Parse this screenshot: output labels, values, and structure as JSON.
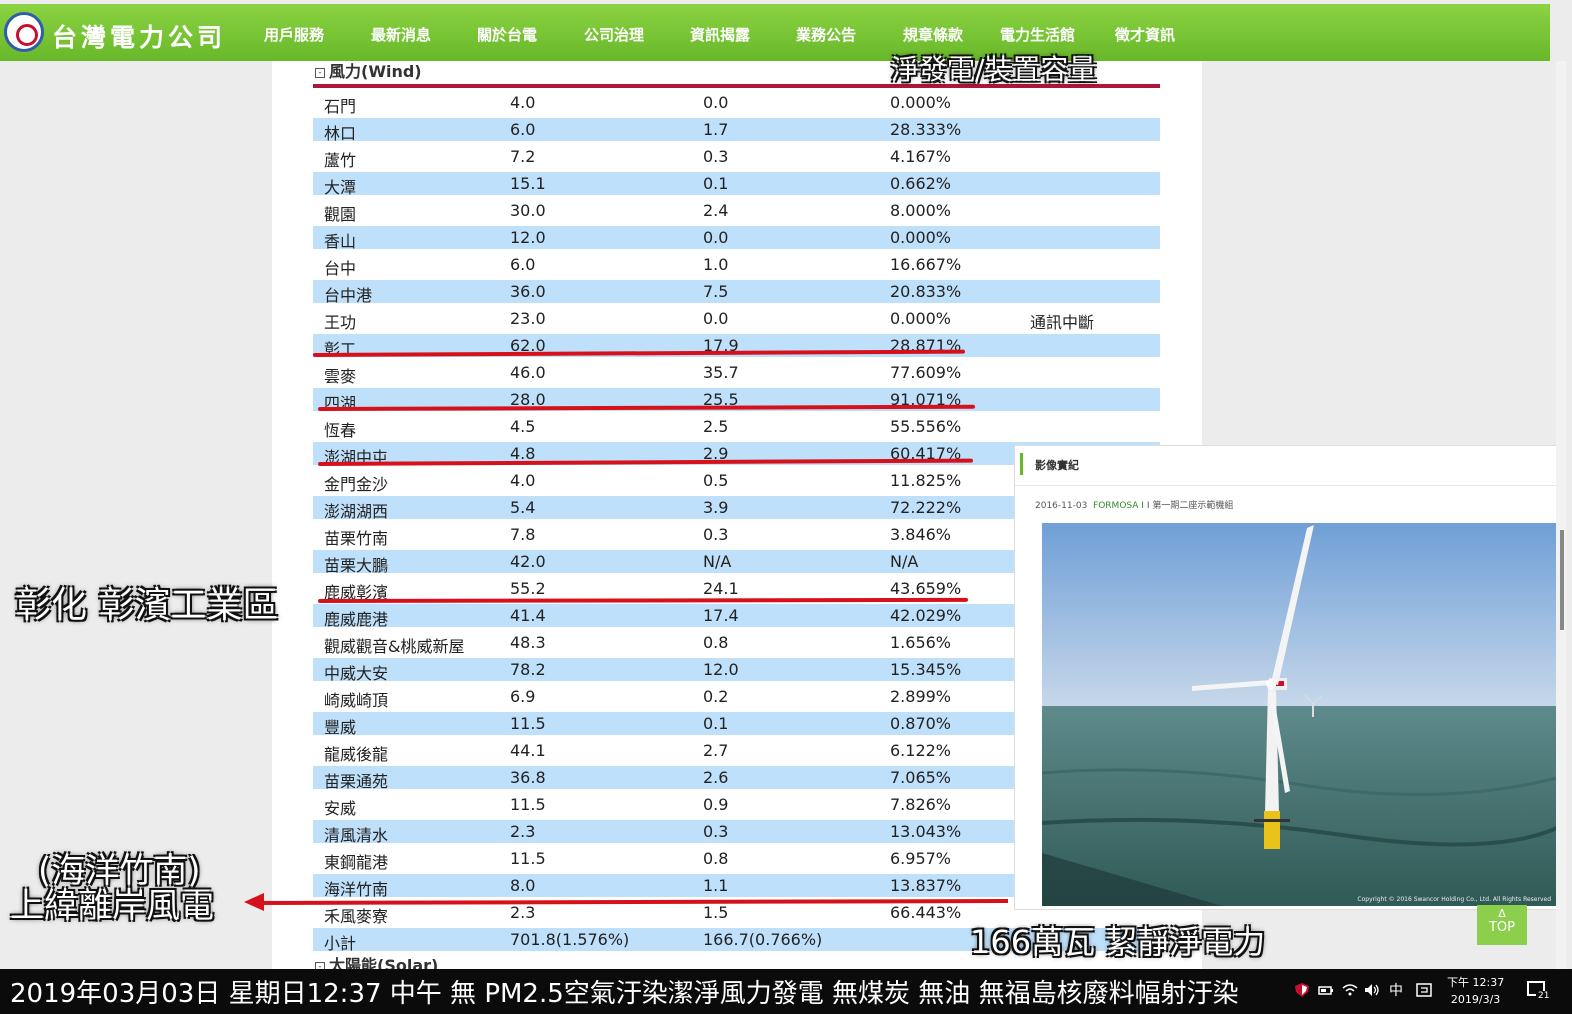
{
  "site": {
    "brand": "台灣電力公司",
    "nav": [
      "用戶服務",
      "最新消息",
      "關於台電",
      "公司治理",
      "資訊揭露",
      "業務公告",
      "規章條款",
      "電力生活館",
      "徵才資訊"
    ]
  },
  "section": {
    "toggle": "⊟",
    "title": "風力(Wind)"
  },
  "table": {
    "rows": [
      {
        "name": "石門",
        "capacity": "4.0",
        "net": "0.0",
        "ratio": "0.000%",
        "note": ""
      },
      {
        "name": "林口",
        "capacity": "6.0",
        "net": "1.7",
        "ratio": "28.333%",
        "note": ""
      },
      {
        "name": "蘆竹",
        "capacity": "7.2",
        "net": "0.3",
        "ratio": "4.167%",
        "note": ""
      },
      {
        "name": "大潭",
        "capacity": "15.1",
        "net": "0.1",
        "ratio": "0.662%",
        "note": ""
      },
      {
        "name": "觀園",
        "capacity": "30.0",
        "net": "2.4",
        "ratio": "8.000%",
        "note": ""
      },
      {
        "name": "香山",
        "capacity": "12.0",
        "net": "0.0",
        "ratio": "0.000%",
        "note": ""
      },
      {
        "name": "台中",
        "capacity": "6.0",
        "net": "1.0",
        "ratio": "16.667%",
        "note": ""
      },
      {
        "name": "台中港",
        "capacity": "36.0",
        "net": "7.5",
        "ratio": "20.833%",
        "note": ""
      },
      {
        "name": "王功",
        "capacity": "23.0",
        "net": "0.0",
        "ratio": "0.000%",
        "note": "通訊中斷"
      },
      {
        "name": "彰工",
        "capacity": "62.0",
        "net": "17.9",
        "ratio": "28.871%",
        "note": ""
      },
      {
        "name": "雲麥",
        "capacity": "46.0",
        "net": "35.7",
        "ratio": "77.609%",
        "note": ""
      },
      {
        "name": "四湖",
        "capacity": "28.0",
        "net": "25.5",
        "ratio": "91.071%",
        "note": ""
      },
      {
        "name": "恆春",
        "capacity": "4.5",
        "net": "2.5",
        "ratio": "55.556%",
        "note": ""
      },
      {
        "name": "澎湖中屯",
        "capacity": "4.8",
        "net": "2.9",
        "ratio": "60.417%",
        "note": ""
      },
      {
        "name": "金門金沙",
        "capacity": "4.0",
        "net": "0.5",
        "ratio": "11.825%",
        "note": ""
      },
      {
        "name": "澎湖湖西",
        "capacity": "5.4",
        "net": "3.9",
        "ratio": "72.222%",
        "note": ""
      },
      {
        "name": "苗栗竹南",
        "capacity": "7.8",
        "net": "0.3",
        "ratio": "3.846%",
        "note": ""
      },
      {
        "name": "苗栗大鵬",
        "capacity": "42.0",
        "net": "N/A",
        "ratio": "N/A",
        "note": ""
      },
      {
        "name": "鹿威彰濱",
        "capacity": "55.2",
        "net": "24.1",
        "ratio": "43.659%",
        "note": ""
      },
      {
        "name": "鹿威鹿港",
        "capacity": "41.4",
        "net": "17.4",
        "ratio": "42.029%",
        "note": ""
      },
      {
        "name": "觀威觀音&桃威新屋",
        "capacity": "48.3",
        "net": "0.8",
        "ratio": "1.656%",
        "note": ""
      },
      {
        "name": "中威大安",
        "capacity": "78.2",
        "net": "12.0",
        "ratio": "15.345%",
        "note": ""
      },
      {
        "name": "崎威崎頂",
        "capacity": "6.9",
        "net": "0.2",
        "ratio": "2.899%",
        "note": ""
      },
      {
        "name": "豐威",
        "capacity": "11.5",
        "net": "0.1",
        "ratio": "0.870%",
        "note": ""
      },
      {
        "name": "龍威後龍",
        "capacity": "44.1",
        "net": "2.7",
        "ratio": "6.122%",
        "note": ""
      },
      {
        "name": "苗栗通苑",
        "capacity": "36.8",
        "net": "2.6",
        "ratio": "7.065%",
        "note": ""
      },
      {
        "name": "安威",
        "capacity": "11.5",
        "net": "0.9",
        "ratio": "7.826%",
        "note": ""
      },
      {
        "name": "清風清水",
        "capacity": "2.3",
        "net": "0.3",
        "ratio": "13.043%",
        "note": ""
      },
      {
        "name": "東鋼龍港",
        "capacity": "11.5",
        "net": "0.8",
        "ratio": "6.957%",
        "note": ""
      },
      {
        "name": "海洋竹南",
        "capacity": "8.0",
        "net": "1.1",
        "ratio": "13.837%",
        "note": ""
      },
      {
        "name": "禾風麥寮",
        "capacity": "2.3",
        "net": "1.5",
        "ratio": "66.443%",
        "note": ""
      },
      {
        "name": "小計",
        "capacity": "701.8(1.576%)",
        "net": "166.7(0.766%)",
        "ratio": "",
        "note": ""
      }
    ]
  },
  "next_section": {
    "toggle": "⊟",
    "title": "太陽能(Solar)"
  },
  "photo_card": {
    "title": "影像實紀",
    "date": "2016-11-03",
    "caption_brand": "FORMOSA I",
    "caption_rest": "第一期二座示範機組",
    "copyright": "Copyright © 2016 Swancor Holding Co., Ltd. All Rights Reserved"
  },
  "top_button": {
    "arrow": "Δ",
    "label": "TOP"
  },
  "overlay": {
    "top_caption": "淨發電/裝置容量",
    "left_caption": "彰化 彰濱工業區",
    "sea_caption_line1": "(海洋竹南)",
    "sea_caption_line2": "上緯離岸風電",
    "bottom_caption": "166萬瓦 絜靜淨電力",
    "ticker": "2019年03月03日 星期日12:37 中午   無 PM2.5空氣汙染潔淨風力發電 無煤炭 無油 無福島核廢料幅射汙染"
  },
  "taskbar": {
    "ime": "中",
    "time": "下午 12:37",
    "date": "2019/3/3",
    "notification_count": "21"
  },
  "colors": {
    "nav_green": "#68b82a",
    "row_blue": "#bfe0fa",
    "marker_red": "#d6111c",
    "header_rule": "#b0153c"
  }
}
